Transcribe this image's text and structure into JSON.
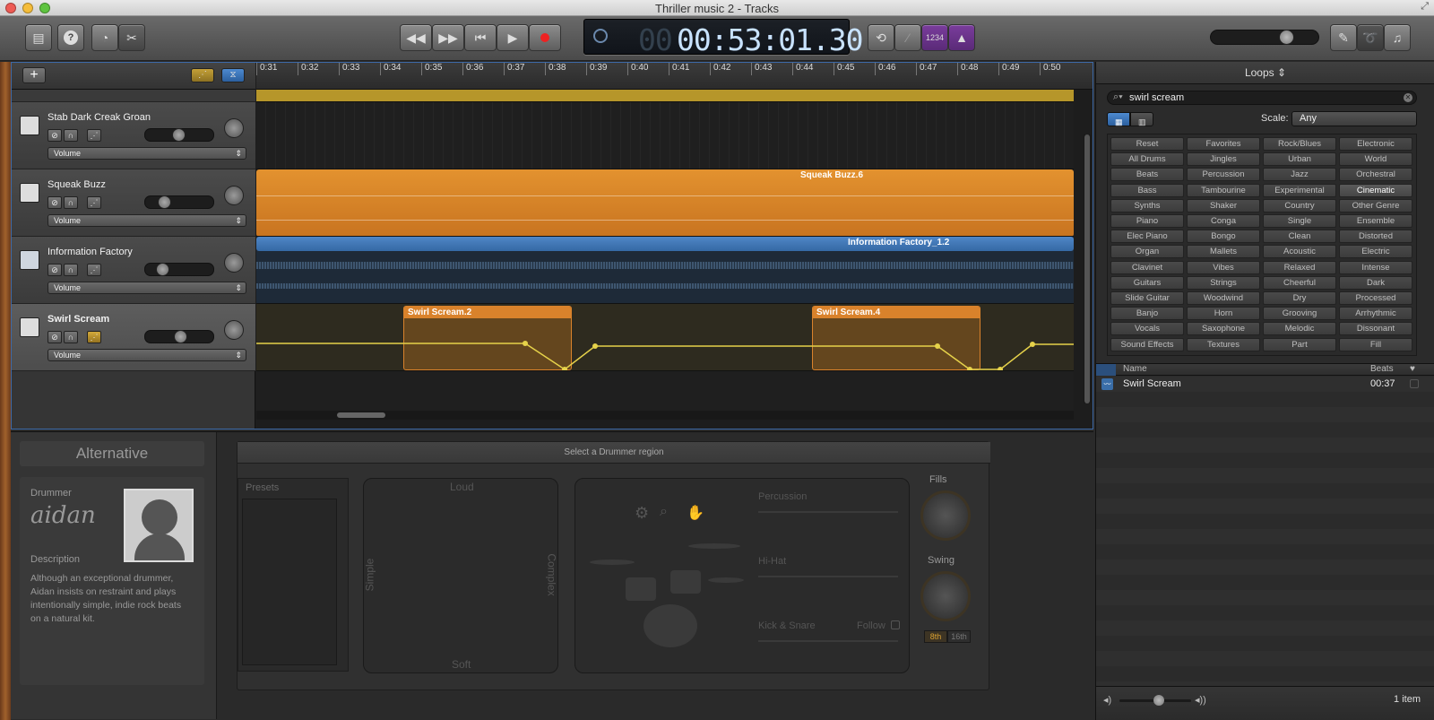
{
  "window": {
    "title": "Thriller music 2 - Tracks"
  },
  "toolbar": {
    "time": "00:53:01.30",
    "time_ghost": "00",
    "count_in": "1234"
  },
  "ruler": {
    "ticks": [
      "0:31",
      "0:32",
      "0:33",
      "0:34",
      "0:35",
      "0:36",
      "0:37",
      "0:38",
      "0:39",
      "0:40",
      "0:41",
      "0:42",
      "0:43",
      "0:44",
      "0:45",
      "0:46",
      "0:47",
      "0:48",
      "0:49",
      "0:50"
    ]
  },
  "tracks": [
    {
      "name": "Stab Dark Creak Groan",
      "param": "Volume"
    },
    {
      "name": "Squeak Buzz",
      "param": "Volume"
    },
    {
      "name": "Information Factory",
      "param": "Volume"
    },
    {
      "name": "Swirl Scream",
      "param": "Volume"
    }
  ],
  "regions": {
    "squeak": "Squeak Buzz.6",
    "info": "Information Factory_1.2",
    "swirl1": "Swirl Scream.2",
    "swirl2": "Swirl Scream.4"
  },
  "editor": {
    "tab_title": "Alternative",
    "drummer_label": "Drummer",
    "drummer_signature": "aidan",
    "description_label": "Description",
    "description": "Although an exceptional drummer, Aidan insists on restraint and plays intentionally simple, indie rock beats on a natural kit.",
    "header_msg": "Select a Drummer region",
    "presets": "Presets",
    "loud": "Loud",
    "soft": "Soft",
    "simple": "Simple",
    "complex": "Complex",
    "percussion": "Percussion",
    "hihat": "Hi-Hat",
    "kick_snare": "Kick & Snare",
    "follow": "Follow",
    "fills": "Fills",
    "swing": "Swing",
    "eighth": "8th",
    "sixteenth": "16th"
  },
  "loops": {
    "title": "Loops ⇕",
    "search": "swirl scream",
    "scale_label": "Scale:",
    "scale_value": "Any",
    "keywords": [
      [
        "Reset",
        "Favorites",
        "Rock/Blues",
        "Electronic"
      ],
      [
        "All Drums",
        "Jingles",
        "Urban",
        "World"
      ],
      [
        "Beats",
        "Percussion",
        "Jazz",
        "Orchestral"
      ],
      [
        "Bass",
        "Tambourine",
        "Experimental",
        "Cinematic"
      ],
      [
        "Synths",
        "Shaker",
        "Country",
        "Other Genre"
      ],
      [
        "Piano",
        "Conga",
        "Single",
        "Ensemble"
      ],
      [
        "Elec Piano",
        "Bongo",
        "Clean",
        "Distorted"
      ],
      [
        "Organ",
        "Mallets",
        "Acoustic",
        "Electric"
      ],
      [
        "Clavinet",
        "Vibes",
        "Relaxed",
        "Intense"
      ],
      [
        "Guitars",
        "Strings",
        "Cheerful",
        "Dark"
      ],
      [
        "Slide Guitar",
        "Woodwind",
        "Dry",
        "Processed"
      ],
      [
        "Banjo",
        "Horn",
        "Grooving",
        "Arrhythmic"
      ],
      [
        "Vocals",
        "Saxophone",
        "Melodic",
        "Dissonant"
      ],
      [
        "Sound Effects",
        "Textures",
        "Part",
        "Fill"
      ]
    ],
    "col_name": "Name",
    "col_beats": "Beats",
    "results": [
      {
        "name": "Swirl Scream",
        "beats": "00:37"
      }
    ],
    "count": "1 item"
  },
  "colors": {
    "accent": "#3d6aa8",
    "orange": "#d9822b",
    "blue": "#3a6ea8",
    "yellow": "#e6d24a",
    "gold": "#b6962a"
  }
}
